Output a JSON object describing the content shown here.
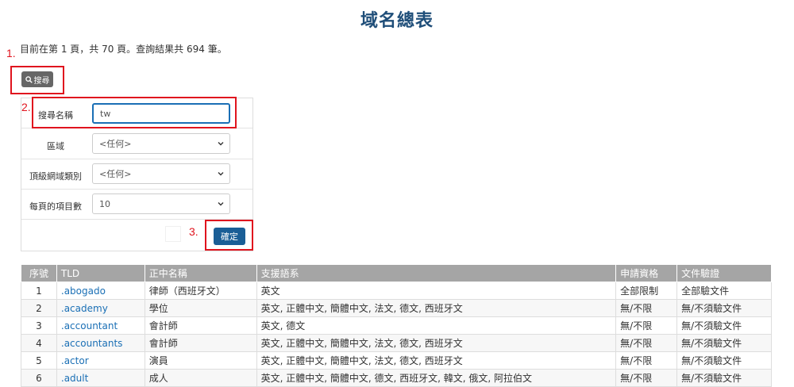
{
  "page": {
    "title": "域名總表"
  },
  "summary": "目前在第 1 頁，共 70 頁。查詢結果共 694 筆。",
  "annotations": [
    "1.",
    "2.",
    "3."
  ],
  "search_button": {
    "label": "搜尋",
    "icon": "search-icon"
  },
  "form": {
    "name": {
      "label": "搜尋名稱",
      "value": "tw"
    },
    "region": {
      "label": "區域",
      "value": "<任何>"
    },
    "tld_type": {
      "label": "頂級網域類別",
      "value": "<任何>"
    },
    "per_page": {
      "label": "每頁的項目數",
      "value": "10"
    },
    "submit_label": "確定"
  },
  "table": {
    "headers": [
      "序號",
      "TLD",
      "正中名稱",
      "支援語系",
      "申請資格",
      "文件驗證"
    ],
    "rows": [
      [
        "1",
        ".abogado",
        "律師（西班牙文）",
        "英文",
        "全部限制",
        "全部驗文件"
      ],
      [
        "2",
        ".academy",
        "學位",
        "英文, 正體中文, 簡體中文, 法文, 德文, 西班牙文",
        "無/不限",
        "無/不須驗文件"
      ],
      [
        "3",
        ".accountant",
        "會計師",
        "英文, 德文",
        "無/不限",
        "無/不須驗文件"
      ],
      [
        "4",
        ".accountants",
        "會計師",
        "英文, 正體中文, 簡體中文, 法文, 德文, 西班牙文",
        "無/不限",
        "無/不須驗文件"
      ],
      [
        "5",
        ".actor",
        "演員",
        "英文, 正體中文, 簡體中文, 法文, 德文, 西班牙文",
        "無/不限",
        "無/不須驗文件"
      ],
      [
        "6",
        ".adult",
        "成人",
        "英文, 正體中文, 簡體中文, 德文, 西班牙文, 韓文, 俄文, 阿拉伯文",
        "無/不限",
        "無/不須驗文件"
      ]
    ]
  },
  "colors": {
    "annotation": "#e0141e",
    "title": "#1f4e79",
    "link": "#1a6fb5",
    "header_bg": "#a5a5a5",
    "button_primary": "#1a5e96"
  }
}
